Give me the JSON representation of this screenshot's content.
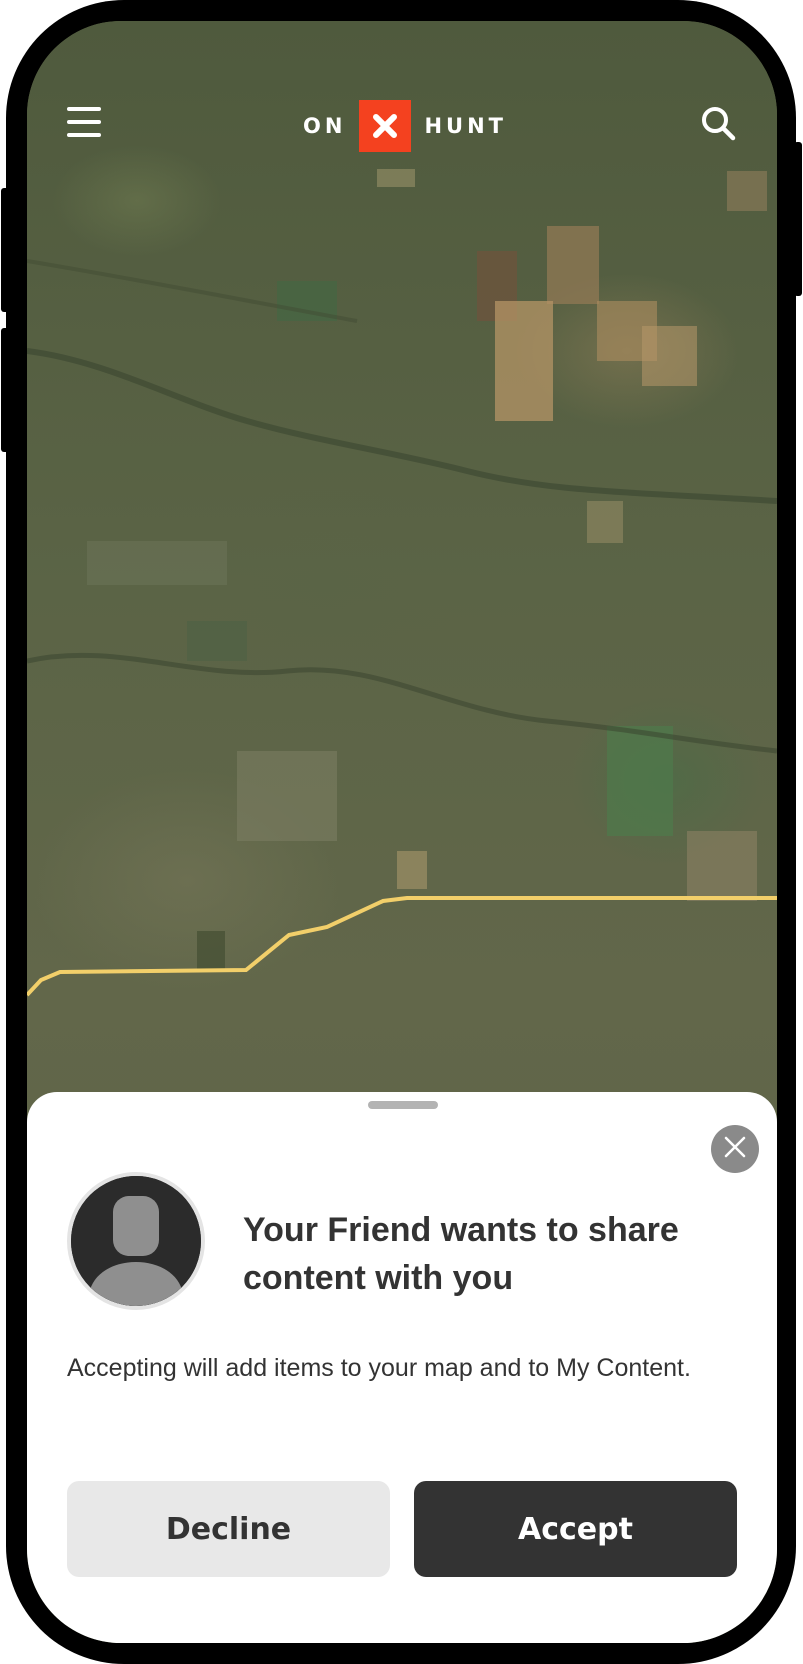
{
  "header": {
    "brand_left": "ON",
    "brand_right": "HUNT",
    "menu_icon": "hamburger-menu-icon",
    "search_icon": "search-icon"
  },
  "share_sheet": {
    "title": "Your Friend wants to share content with you",
    "description": "Accepting will add items to your map and to My Content.",
    "decline_label": "Decline",
    "accept_label": "Accept",
    "avatar_icon": "default-user-avatar-icon",
    "close_icon": "close-icon"
  },
  "colors": {
    "brand_accent": "#f4411f",
    "accept_button": "#333333",
    "decline_button": "#e8e8e8",
    "boundary_line": "#f2cf6a"
  }
}
